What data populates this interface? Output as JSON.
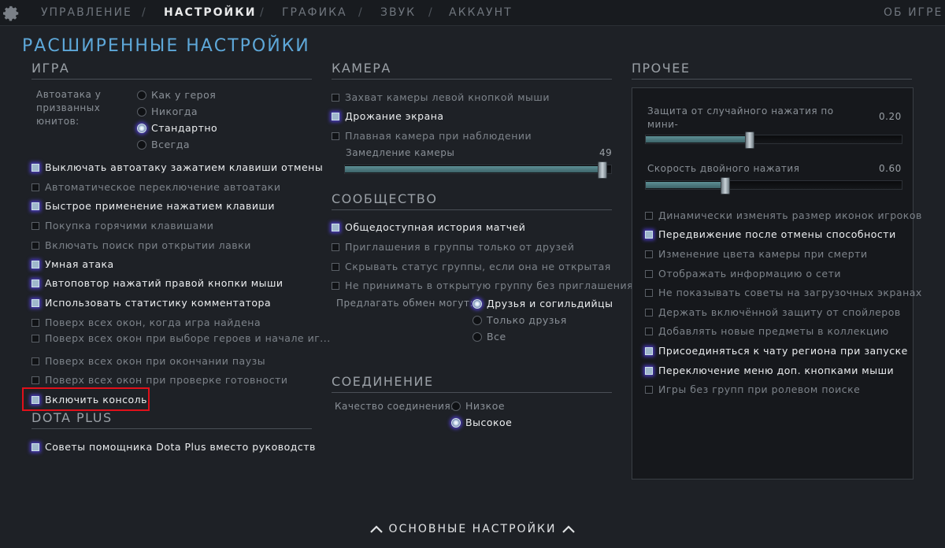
{
  "nav": {
    "tabs": [
      "УПРАВЛЕНИЕ",
      "НАСТРОЙКИ",
      "ГРАФИКА",
      "ЗВУК",
      "АККАУНТ"
    ],
    "separator": "/",
    "about": "ОБ ИГРЕ"
  },
  "page_title": "РАСШИРЕННЫЕ НАСТРОЙКИ",
  "game": {
    "title": "ИГРА",
    "autoattack_label": "Автоатака у\nпризванных\nюнитов:",
    "autoattack_options": [
      "Как у героя",
      "Никогда",
      "Стандартно",
      "Всегда"
    ],
    "autoattack_selected": "Стандартно",
    "checkboxes": [
      {
        "label": "Выключать автоатаку зажатием клавиши отмены",
        "checked": true
      },
      {
        "label": "Автоматическое переключение автоатаки",
        "checked": false
      },
      {
        "label": "Быстрое применение нажатием клавиши",
        "checked": true
      },
      {
        "label": "Покупка горячими клавишами",
        "checked": false
      },
      {
        "label": "Включать поиск при открытии лавки",
        "checked": false
      },
      {
        "label": "Умная атака",
        "checked": true
      },
      {
        "label": "Автоповтор нажатий правой кнопки мыши",
        "checked": true
      },
      {
        "label": "Использовать статистику комментатора",
        "checked": true
      },
      {
        "label": "Поверх всех окон, когда игра найдена",
        "checked": false
      },
      {
        "label": "Поверх всех окон при выборе героев и начале иг...",
        "checked": false
      },
      {
        "label": "Поверх всех окон при окончании паузы",
        "checked": false
      },
      {
        "label": "Поверх всех окон при проверке готовности",
        "checked": false
      },
      {
        "label": "Включить консоль",
        "checked": true
      }
    ]
  },
  "dotaplus": {
    "title": "DOTA PLUS",
    "checkboxes": [
      {
        "label": "Советы помощника Dota Plus вместо руководств",
        "checked": true
      }
    ]
  },
  "camera": {
    "title": "КАМЕРА",
    "checkboxes": [
      {
        "label": "Захват камеры левой кнопкой мыши",
        "checked": false
      },
      {
        "label": "Дрожание экрана",
        "checked": true
      },
      {
        "label": "Плавная камера при наблюдении",
        "checked": false
      }
    ],
    "slowdown_label": "Замедление камеры",
    "slowdown_value": "49",
    "slowdown_fraction": 0.98
  },
  "community": {
    "title": "СООБЩЕСТВО",
    "checkboxes": [
      {
        "label": "Общедоступная история матчей",
        "checked": true
      },
      {
        "label": "Приглашения в группы только от друзей",
        "checked": false
      },
      {
        "label": "Скрывать статус группы, если она не открытая",
        "checked": false
      },
      {
        "label": "Не принимать в открытую группу без приглашения",
        "checked": false
      }
    ],
    "trade_label": "Предлагать обмен могут:",
    "trade_options": [
      "Друзья и согильдийцы",
      "Только друзья",
      "Все"
    ],
    "trade_selected": "Друзья и согильдийцы"
  },
  "connection": {
    "title": "СОЕДИНЕНИЕ",
    "quality_label": "Качество соединения:",
    "quality_options": [
      "Низкое",
      "Высокое"
    ],
    "quality_selected": "Высокое"
  },
  "other": {
    "title": "ПРОЧЕЕ",
    "minimap_label": "Защита от случайного нажатия по мини-\nкарте",
    "minimap_value": "0.20",
    "minimap_fraction": 0.4,
    "doubletap_label": "Скорость двойного нажатия",
    "doubletap_value": "0.60",
    "doubletap_fraction": 0.3,
    "checkboxes": [
      {
        "label": "Динамически изменять размер иконок игроков",
        "checked": false
      },
      {
        "label": "Передвижение после отмены способности",
        "checked": true
      },
      {
        "label": "Изменение цвета камеры при смерти",
        "checked": false
      },
      {
        "label": "Отображать информацию о сети",
        "checked": false
      },
      {
        "label": "Не показывать советы на загрузочных экранах",
        "checked": false
      },
      {
        "label": "Держать включённой защиту от спойлеров",
        "checked": false
      },
      {
        "label": "Добавлять новые предметы в коллекцию",
        "checked": false
      },
      {
        "label": "Присоединяться к чату региона при запуске",
        "checked": true
      },
      {
        "label": "Переключение меню доп. кнопками мыши",
        "checked": true
      },
      {
        "label": "Игры без групп при ролевом поиске",
        "checked": false
      }
    ]
  },
  "footer": {
    "label": "ОСНОВНЫЕ НАСТРОЙКИ"
  }
}
